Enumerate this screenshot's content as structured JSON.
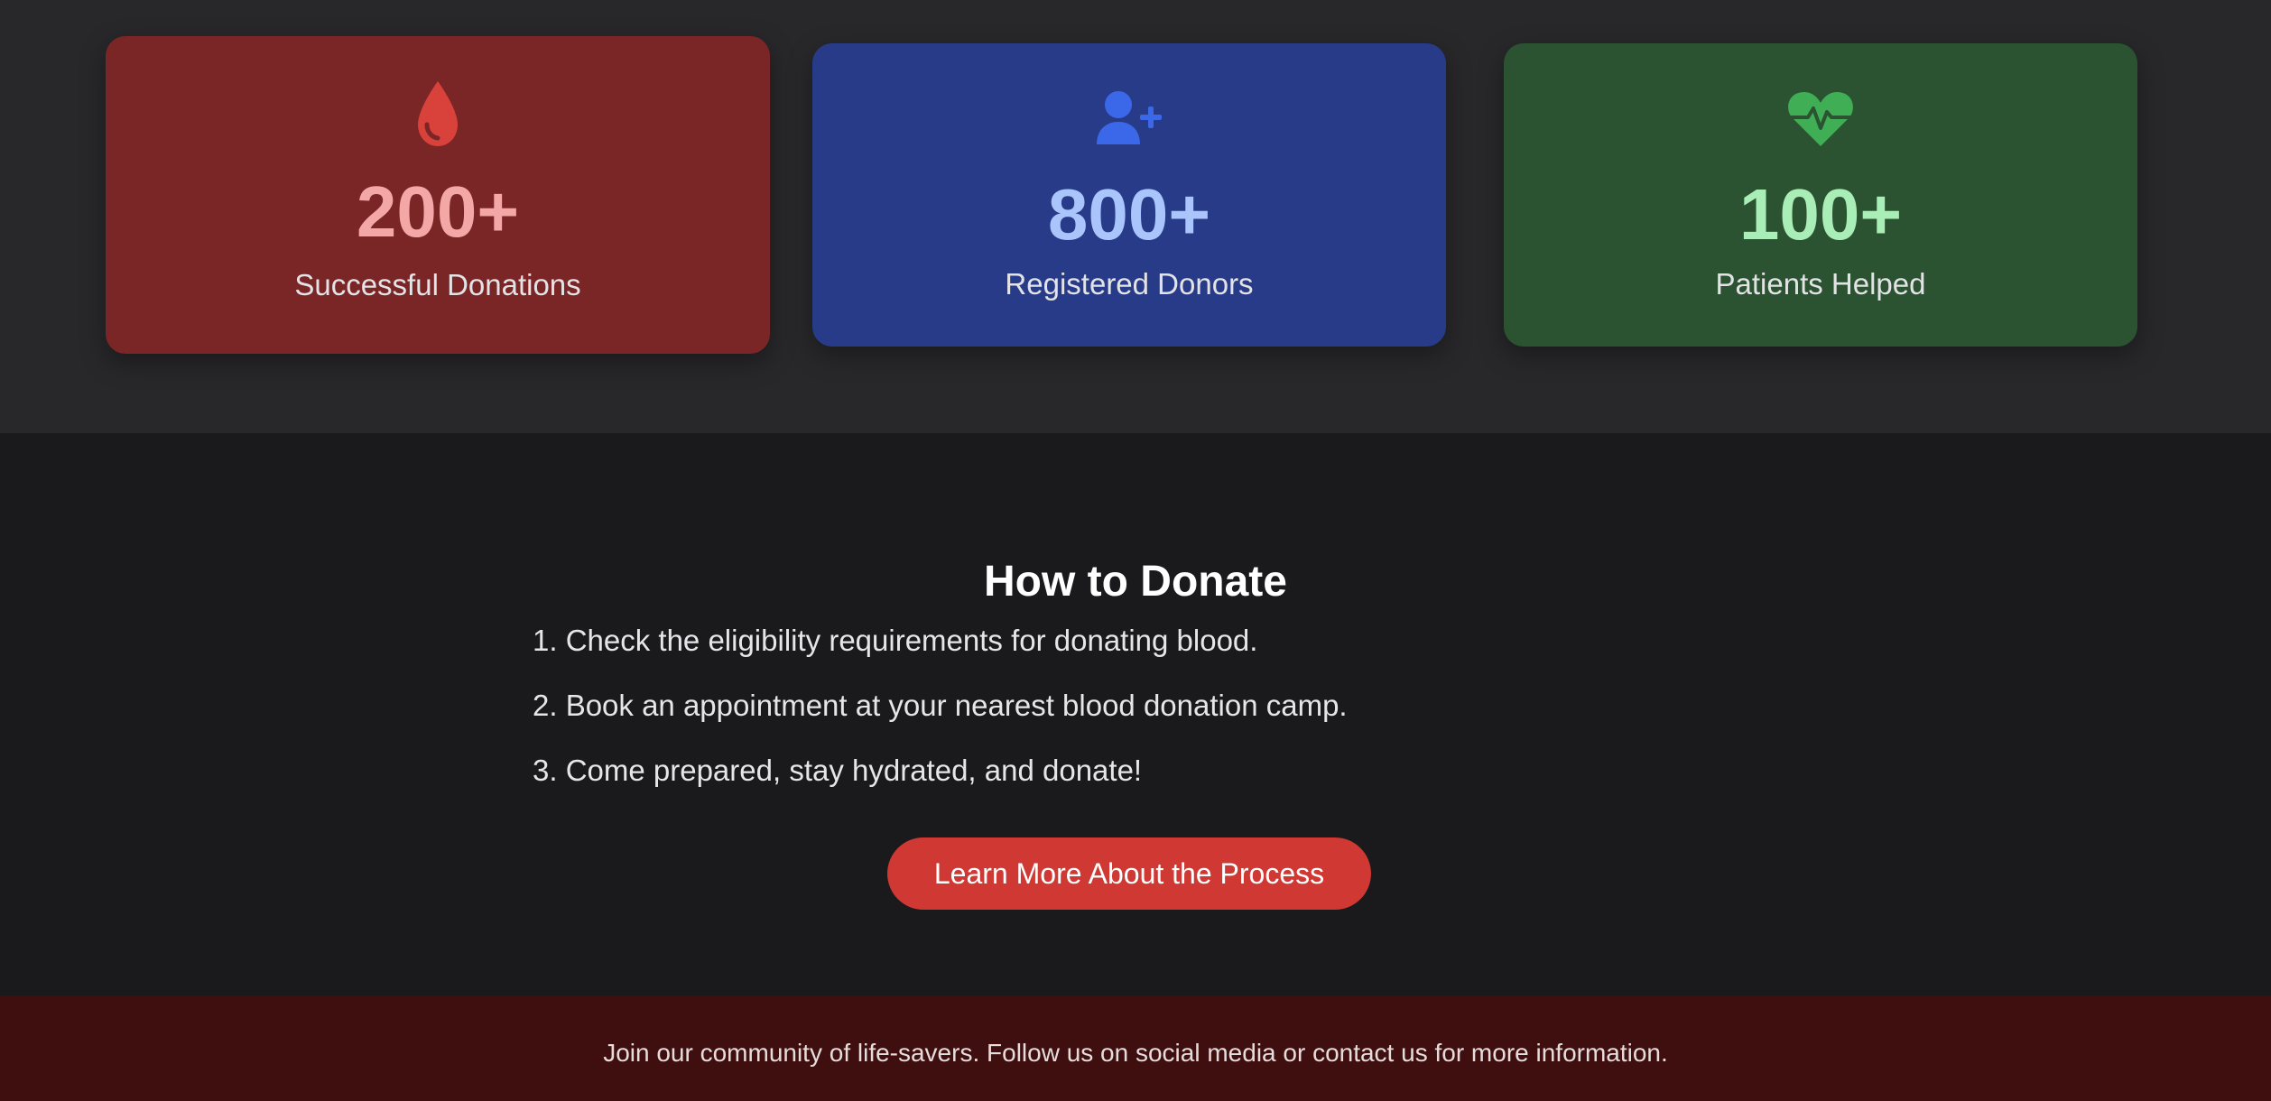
{
  "stats": [
    {
      "icon": "blood-drop-icon",
      "value": "200+",
      "label": "Successful Donations",
      "accent": "#f4a7a7",
      "background": "#7a2526"
    },
    {
      "icon": "add-user-icon",
      "value": "800+",
      "label": "Registered Donors",
      "accent": "#a9c5fb",
      "background": "#273b89"
    },
    {
      "icon": "heart-pulse-icon",
      "value": "100+",
      "label": "Patients Helped",
      "accent": "#a8eeb6",
      "background": "#2b5332"
    }
  ],
  "how_to_donate": {
    "title": "How to Donate",
    "steps": [
      "1. Check the eligibility requirements for donating blood.",
      "2. Book an appointment at your nearest blood donation camp.",
      "3. Come prepared, stay hydrated, and donate!"
    ],
    "button_label": "Learn More About the Process",
    "button_color": "#cf3833"
  },
  "footer": {
    "text": "Join our community of life-savers. Follow us on social media or contact us for more information."
  }
}
